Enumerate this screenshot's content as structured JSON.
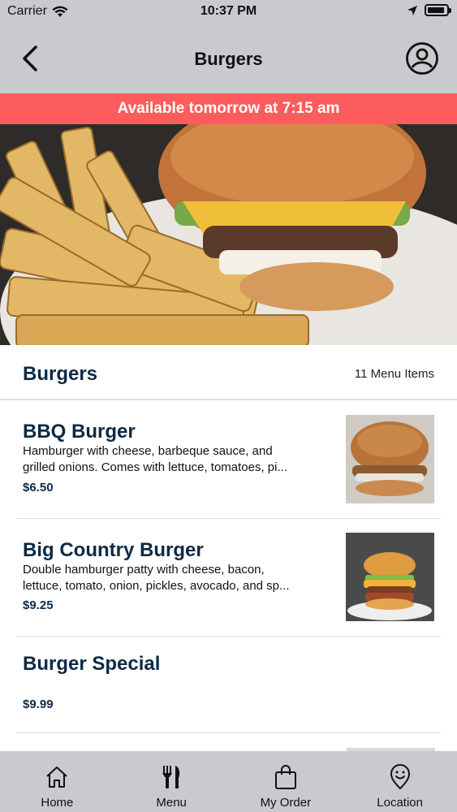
{
  "status_bar": {
    "carrier": "Carrier",
    "time": "10:37 PM"
  },
  "header": {
    "title": "Burgers",
    "back_icon": "chevron-left-icon",
    "profile_icon": "user-circle-icon"
  },
  "banner": {
    "text": "Available tomorrow at 7:15 am",
    "color": "#fd5c5c"
  },
  "category": {
    "name": "Burgers",
    "count_label": "11 Menu Items"
  },
  "items": [
    {
      "name": "BBQ Burger",
      "description": "Hamburger with cheese, barbeque sauce, and grilled onions.  Comes with lettuce, tomatoes, pi...",
      "price": "$6.50"
    },
    {
      "name": "Big Country Burger",
      "description": "Double hamburger patty with cheese, bacon, lettuce, tomato, onion, pickles, avocado, and sp...",
      "price": "$9.25"
    },
    {
      "name": "Burger Special",
      "description": "",
      "price": "$9.99"
    }
  ],
  "tabs": [
    {
      "label": "Home",
      "icon": "home-icon"
    },
    {
      "label": "Menu",
      "icon": "fork-knife-icon"
    },
    {
      "label": "My Order",
      "icon": "shopping-bag-icon"
    },
    {
      "label": "Location",
      "icon": "location-pin-icon"
    }
  ],
  "colors": {
    "navy": "#0d2a45",
    "bar_gray": "#c8cacd"
  }
}
